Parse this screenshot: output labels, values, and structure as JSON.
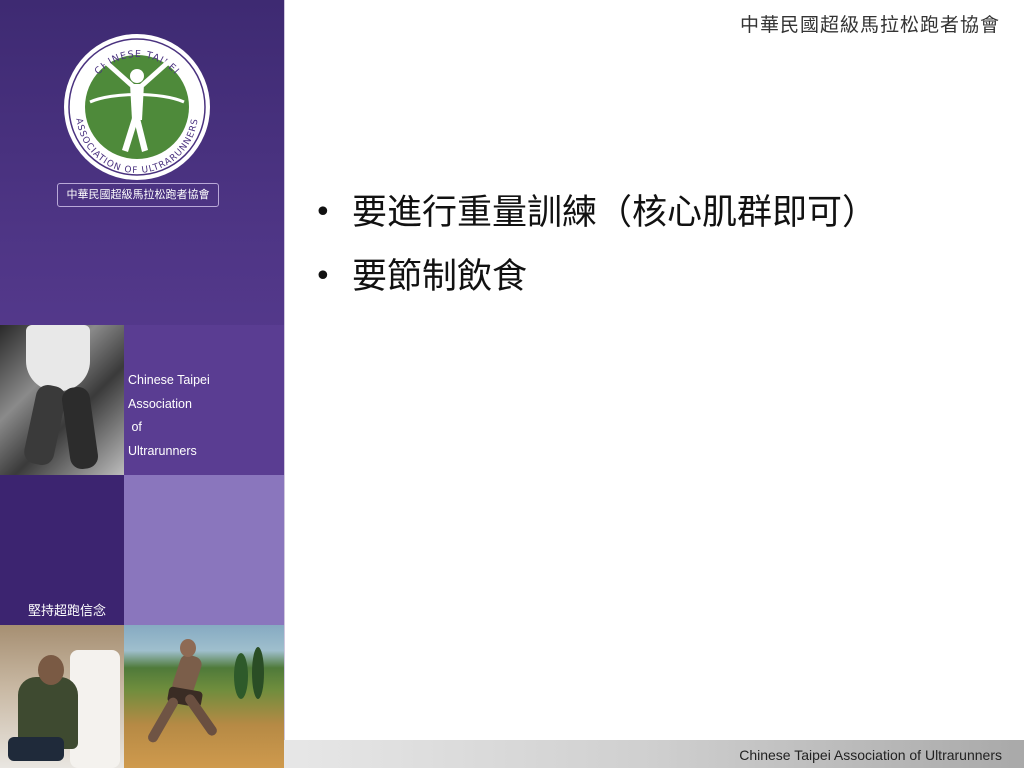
{
  "header": {
    "org_title": "中華民國超級馬拉松跑者協會"
  },
  "logo": {
    "ring_text_top": "CHINESE TAIPEI",
    "ring_text_bottom": "ASSOCIATION OF ULTRARUNNERS",
    "caption": "中華民國超級馬拉松跑者協會"
  },
  "sidebar": {
    "association_text": "Chinese Taipei\nAssociation\n of\nUltrarunners",
    "slogan": "堅持超跑信念"
  },
  "content": {
    "bullets": [
      "要進行重量訓練（核心肌群即可）",
      "要節制飲食"
    ]
  },
  "footer": {
    "text": "Chinese Taipei Association of Ultrarunners"
  },
  "colors": {
    "panel_purple": "#5a3d92",
    "dark_purple": "#3c2470",
    "light_purple": "#8a76bd",
    "logo_green": "#4e8a3a"
  }
}
